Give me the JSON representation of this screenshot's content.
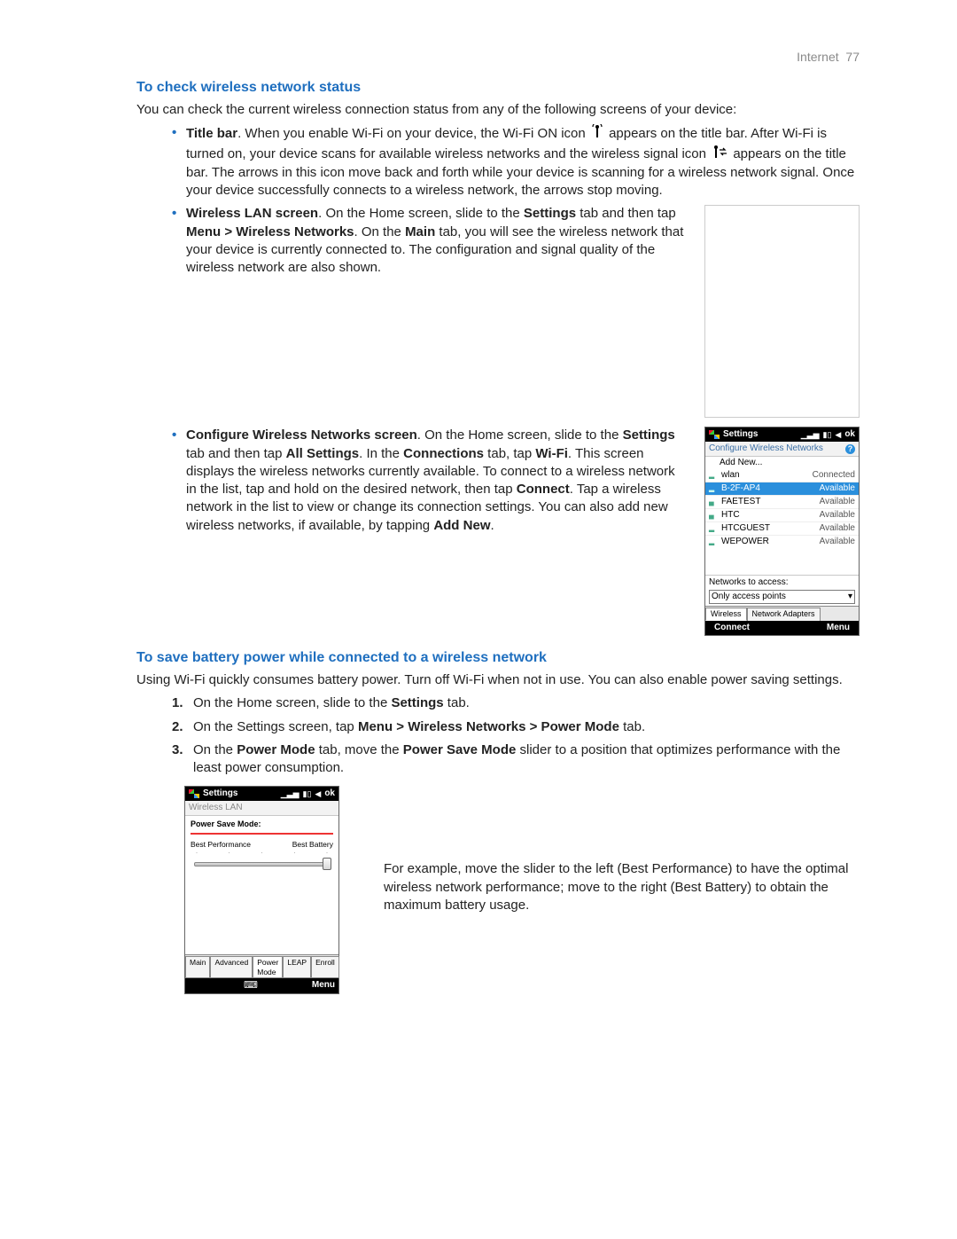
{
  "page_header": {
    "section": "Internet",
    "page_number": "77"
  },
  "s1": {
    "heading": "To check wireless network status",
    "intro": "You can check the current wireless connection status from any of the following screens of your device:",
    "b1": {
      "lead": "Title bar",
      "t1": ". When you enable Wi-Fi on your device, the Wi-Fi ON icon ",
      "t2": " appears on the title bar. After Wi-Fi is turned on, your device scans for available wireless networks and the wireless signal icon ",
      "t3": " appears on the title bar. The arrows in this icon move back and forth while your device is scanning for a wireless network signal. Once your device successfully connects to a wireless network, the arrows stop moving."
    },
    "b2": {
      "lead": "Wireless LAN screen",
      "t1": ". On the Home screen, slide to the ",
      "k1": "Settings",
      "t2": " tab and then tap ",
      "k2": "Menu > Wireless Networks",
      "t3": ". On the ",
      "k3": "Main",
      "t4": " tab, you will see the wireless network that your device is currently connected to. The configuration and signal quality of the wireless network are also shown."
    },
    "b3": {
      "lead": "Configure Wireless Networks screen",
      "t1": ". On the Home screen, slide to the ",
      "k1": "Settings",
      "t2": " tab and then tap ",
      "k2": "All Settings",
      "t3": ". In the ",
      "k3": "Connections",
      "t4": " tab, tap ",
      "k4": "Wi-Fi",
      "t5": ". This screen displays the wireless networks currently available. To connect to a wireless network in the list, tap and hold on the desired network, then tap ",
      "k5": "Connect",
      "t6": ". Tap a wireless network in the list to view or change its connection settings. You can also add new wireless networks, if available, by tapping ",
      "k6": "Add New",
      "t7": "."
    }
  },
  "cwn": {
    "title": "Settings",
    "ok": "ok",
    "subhead": "Configure Wireless Networks",
    "addnew": "Add New...",
    "items": [
      {
        "sig": "▂",
        "name": "wlan",
        "status": "Connected",
        "selected": false
      },
      {
        "sig": "▂",
        "name": "B-2F-AP4",
        "status": "Available",
        "selected": true
      },
      {
        "sig": "▄",
        "name": "FAETEST",
        "status": "Available",
        "selected": false
      },
      {
        "sig": "▄",
        "name": "HTC",
        "status": "Available",
        "selected": false
      },
      {
        "sig": "▂",
        "name": "HTCGUEST",
        "status": "Available",
        "selected": false
      },
      {
        "sig": "▂",
        "name": "WEPOWER",
        "status": "Available",
        "selected": false
      }
    ],
    "access_label": "Networks to access:",
    "access_value": "Only access points",
    "tabs": [
      "Wireless",
      "Network Adapters"
    ],
    "soft_left": "Connect",
    "soft_right": "Menu"
  },
  "s2": {
    "heading": "To save battery power while connected to a wireless network",
    "intro": "Using Wi-Fi quickly consumes battery power. Turn off Wi-Fi when not in use. You can also enable power saving settings.",
    "step1": {
      "t1": "On the Home screen, slide to the ",
      "k1": "Settings",
      "t2": " tab."
    },
    "step2": {
      "t1": "On the Settings screen, tap ",
      "k1": "Menu > Wireless Networks > Power Mode",
      "t2": " tab."
    },
    "step3": {
      "t1": "On the ",
      "k1": "Power Mode",
      "t2": " tab, move the ",
      "k2": "Power Save Mode",
      "t3": " slider to a position that optimizes performance with the least power consumption."
    },
    "caption": "For example, move the slider to the left (Best Performance) to have the optimal wireless network performance; move to the right (Best Battery) to obtain the maximum battery usage."
  },
  "psm": {
    "title": "Settings",
    "ok": "ok",
    "sub": "Wireless LAN",
    "heading": "Power Save Mode:",
    "left_label": "Best Performance",
    "right_label": "Best Battery",
    "tabs": [
      "Main",
      "Advanced",
      "Power Mode",
      "LEAP",
      "Enroll"
    ],
    "soft_right": "Menu"
  }
}
